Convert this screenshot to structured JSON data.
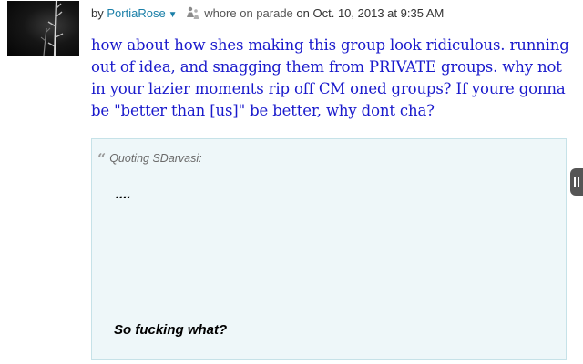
{
  "post": {
    "by_label": "by",
    "author": "PortiaRose",
    "author_menu_icon": "chevron-down-icon",
    "group_icon": "group-people-icon",
    "group_name": "whore on parade",
    "on_label": "on",
    "timestamp": "Oct. 10, 2013 at 9:35 AM",
    "body": "how about how shes making this group look ridiculous. running out of idea, and snagging them from PRIVATE groups. why not in your lazier moments rip off CM oned groups? If youre gonna be \"better than [us]\" be better, why dont cha?"
  },
  "quote": {
    "icon": "quote-mark-icon",
    "label": "Quoting SDarvasi:",
    "line1": "....",
    "line2": "So fucking what?"
  },
  "side_handle": {
    "icon": "pause-handle-icon"
  },
  "colors": {
    "author_link": "#1a7fa8",
    "body_text": "#1a1acc",
    "quote_bg": "#eef7f9",
    "quote_border": "#c6e2e8"
  }
}
